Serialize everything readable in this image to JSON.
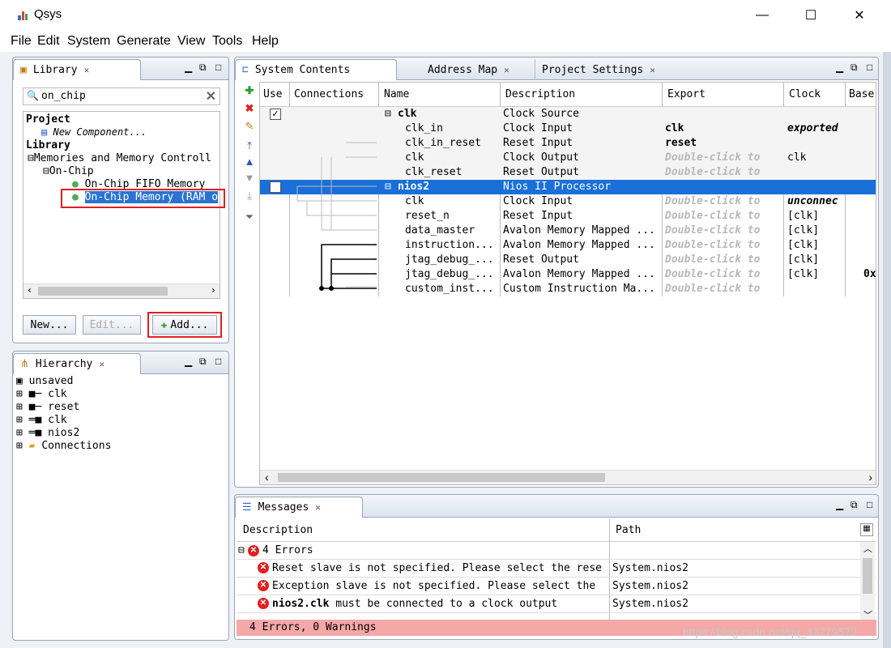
{
  "window": {
    "title": "Qsys",
    "minimize": "—",
    "maximize": "☐",
    "close": "✕"
  },
  "menu": [
    "File",
    "Edit",
    "System",
    "Generate",
    "View",
    "Tools",
    "Help"
  ],
  "library": {
    "tab_label": "Library",
    "search_value": "on_chip",
    "tree": {
      "project": "Project",
      "new_component": "New Component...",
      "library": "Library",
      "memories": "Memories and Memory Controll",
      "on_chip": "On-Chip",
      "fifo": "On-Chip FIFO Memory",
      "ram": "On-Chip Memory (RAM o"
    },
    "buttons": {
      "new": "New...",
      "edit": "Edit...",
      "add": "Add..."
    }
  },
  "hierarchy": {
    "tab_label": "Hierarchy",
    "root": "unsaved",
    "items": [
      "clk",
      "reset",
      "clk",
      "nios2",
      "Connections"
    ]
  },
  "system": {
    "tabs": [
      "System Contents",
      "Address Map",
      "Project Settings"
    ],
    "columns": [
      "Use",
      "Connections",
      "Name",
      "Description",
      "Export",
      "Clock",
      "Base"
    ],
    "placeholder": "Double-click to",
    "rows": [
      {
        "name": "clk",
        "desc": "Clock Source",
        "export": "",
        "clock": "",
        "base": ""
      },
      {
        "name": "clk_in",
        "desc": "Clock Input",
        "export": "clk",
        "clock": "exported",
        "base": ""
      },
      {
        "name": "clk_in_reset",
        "desc": "Reset Input",
        "export": "reset",
        "clock": "",
        "base": ""
      },
      {
        "name": "clk",
        "desc": "Clock Output",
        "export": "",
        "clock": "clk",
        "base": ""
      },
      {
        "name": "clk_reset",
        "desc": "Reset Output",
        "export": "",
        "clock": "",
        "base": ""
      },
      {
        "name": "nios2",
        "desc": "Nios II Processor",
        "export": "",
        "clock": "",
        "base": ""
      },
      {
        "name": "clk",
        "desc": "Clock Input",
        "export": "",
        "clock": "unconnec",
        "base": ""
      },
      {
        "name": "reset_n",
        "desc": "Reset Input",
        "export": "",
        "clock": "[clk]",
        "base": ""
      },
      {
        "name": "data_master",
        "desc": "Avalon Memory Mapped ...",
        "export": "",
        "clock": "[clk]",
        "base": ""
      },
      {
        "name": "instruction...",
        "desc": "Avalon Memory Mapped ...",
        "export": "",
        "clock": "[clk]",
        "base": ""
      },
      {
        "name": "jtag_debug_...",
        "desc": "Reset Output",
        "export": "",
        "clock": "[clk]",
        "base": ""
      },
      {
        "name": "jtag_debug_...",
        "desc": "Avalon Memory Mapped ...",
        "export": "",
        "clock": "[clk]",
        "base": "0x"
      },
      {
        "name": "custom_inst...",
        "desc": "Custom Instruction Ma...",
        "export": "",
        "clock": "",
        "base": ""
      }
    ]
  },
  "messages": {
    "tab_label": "Messages",
    "columns": [
      "Description",
      "Path"
    ],
    "group": "4 Errors",
    "rows": [
      {
        "desc_bold": "",
        "desc": "Reset slave is not specified. Please select the rese",
        "path": "System.nios2"
      },
      {
        "desc_bold": "",
        "desc": "Exception slave is not specified. Please select the",
        "path": "System.nios2"
      },
      {
        "desc_bold": "nios2.clk",
        "desc": " must be connected to a clock output",
        "path": "System.nios2"
      }
    ],
    "status": "4 Errors, 0 Warnings"
  },
  "watermark": "https://blog.csdn.net/qq_43279579"
}
